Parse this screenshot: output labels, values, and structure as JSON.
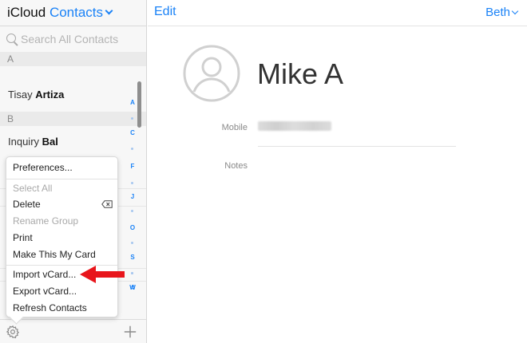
{
  "sidebar": {
    "brand": "iCloud",
    "section": "Contacts",
    "search_placeholder": "Search All Contacts",
    "sections": [
      {
        "letter": "A",
        "contacts": [
          {
            "first": "Tisay",
            "last": "Artiza"
          }
        ]
      },
      {
        "letter": "B",
        "contacts": [
          {
            "first": "Inquiry",
            "last": "Bal"
          }
        ]
      }
    ],
    "index": [
      "A",
      "C",
      "F",
      "J",
      "O",
      "S",
      "W",
      "#"
    ]
  },
  "menu": {
    "items": [
      {
        "label": "Preferences...",
        "enabled": true
      },
      {
        "label": "Select All",
        "enabled": false
      },
      {
        "label": "Delete",
        "enabled": true
      },
      {
        "label": "Rename Group",
        "enabled": false
      },
      {
        "label": "Print",
        "enabled": true
      },
      {
        "label": "Make This My Card",
        "enabled": true
      },
      {
        "label": "Import vCard...",
        "enabled": true
      },
      {
        "label": "Export vCard...",
        "enabled": true
      },
      {
        "label": "Refresh Contacts",
        "enabled": true
      }
    ]
  },
  "header": {
    "edit_label": "Edit",
    "account_label": "Beth"
  },
  "contact": {
    "name": "Mike A",
    "fields": [
      {
        "label": "Mobile"
      },
      {
        "label": "Notes"
      }
    ]
  },
  "colors": {
    "accent": "#1a82f7",
    "annotation_arrow": "#e8151b"
  }
}
